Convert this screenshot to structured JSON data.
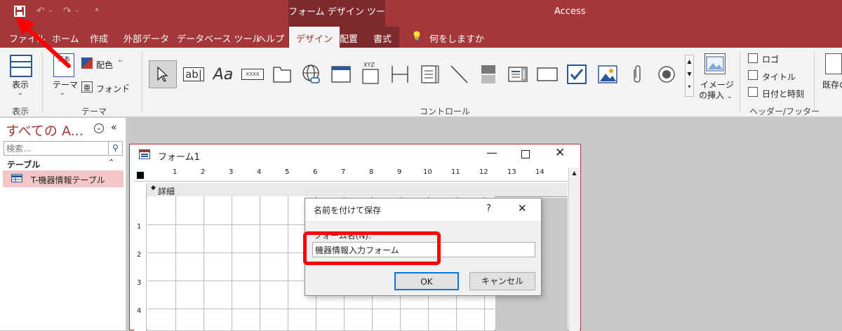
{
  "titlebar": {
    "context_tab": "フォーム デザイン ツール",
    "app_title": "Access"
  },
  "tabs": [
    {
      "label": "ファイル"
    },
    {
      "label": "ホーム"
    },
    {
      "label": "作成"
    },
    {
      "label": "外部データ"
    },
    {
      "label": "データベース ツール"
    },
    {
      "label": "ヘルプ"
    },
    {
      "label": "デザイン"
    },
    {
      "label": "配置"
    },
    {
      "label": "書式"
    }
  ],
  "tell_me": "何をしますか",
  "ribbon": {
    "view_label": "表示",
    "view_group": "表示",
    "theme_label": "テーマ",
    "color_label": "配色",
    "font_label": "フォント",
    "theme_group": "テーマ",
    "controls_group": "コントロール",
    "xyz_text": "XYZ",
    "image_insert": "イメージ",
    "image_insert2": "の挿入",
    "logo_label": "ロゴ",
    "title_label": "タイトル",
    "datetime_label": "日付と時刻",
    "header_group": "ヘッダー/フッター",
    "existing_label": "既存の"
  },
  "navpane": {
    "title": "すべての A...",
    "search_placeholder": "検索...",
    "section": "テーブル",
    "items": [
      {
        "label": "T-機器情報テーブル"
      }
    ]
  },
  "formwin": {
    "title": "フォーム1",
    "detail_label": "詳細"
  },
  "ruler": {
    "h_numbers": [
      "1",
      "2",
      "3",
      "4",
      "5",
      "6",
      "7",
      "8",
      "9",
      "10",
      "11",
      "12",
      "13",
      "14"
    ],
    "v_numbers": [
      "1",
      "2",
      "3",
      "4"
    ]
  },
  "dialog": {
    "title": "名前を付けて保存",
    "help": "?",
    "field_label": "フォーム名(N):",
    "value": "機器情報入力フォーム",
    "ok": "OK",
    "cancel": "キャンセル"
  },
  "colors": {
    "accent": "#a4373a",
    "highlight": "#ff0000"
  }
}
